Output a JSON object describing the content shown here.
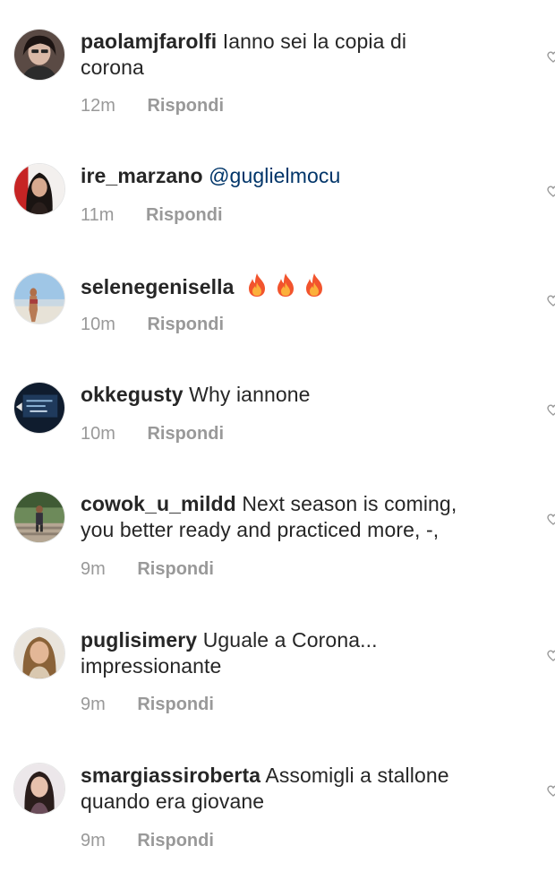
{
  "comments": [
    {
      "username": "paolamjfarolfi",
      "text_line1": "Ianno sei la copia di",
      "text_line2": "corona",
      "time": "12m",
      "reply": "Rispondi"
    },
    {
      "username": "ire_marzano",
      "mention": "@guglielmocu",
      "time": "11m",
      "reply": "Rispondi"
    },
    {
      "username": "selenegenisella",
      "emojis": [
        "fire-emoji",
        "fire-emoji",
        "fire-emoji"
      ],
      "time": "10m",
      "reply": "Rispondi"
    },
    {
      "username": "okkegusty",
      "text_line1": "Why iannone",
      "time": "10m",
      "reply": "Rispondi"
    },
    {
      "username": "cowok_u_mildd",
      "text_line1": "Next season is coming,",
      "text_line2": "you better ready and practiced more, -,",
      "time": "9m",
      "reply": "Rispondi"
    },
    {
      "username": "puglisimery",
      "text_line1": "Uguale a Corona...",
      "text_line2": "impressionante",
      "time": "9m",
      "reply": "Rispondi"
    },
    {
      "username": "smargiassiroberta",
      "text_line1": "Assomigli a stallone",
      "text_line2": "quando era giovane",
      "time": "9m",
      "reply": "Rispondi"
    }
  ],
  "icons": {
    "like": "heart-outline-icon",
    "emoji": "fire-emoji"
  },
  "colors": {
    "text": "#262626",
    "muted": "#999999",
    "mention": "#003569",
    "background": "#ffffff"
  }
}
